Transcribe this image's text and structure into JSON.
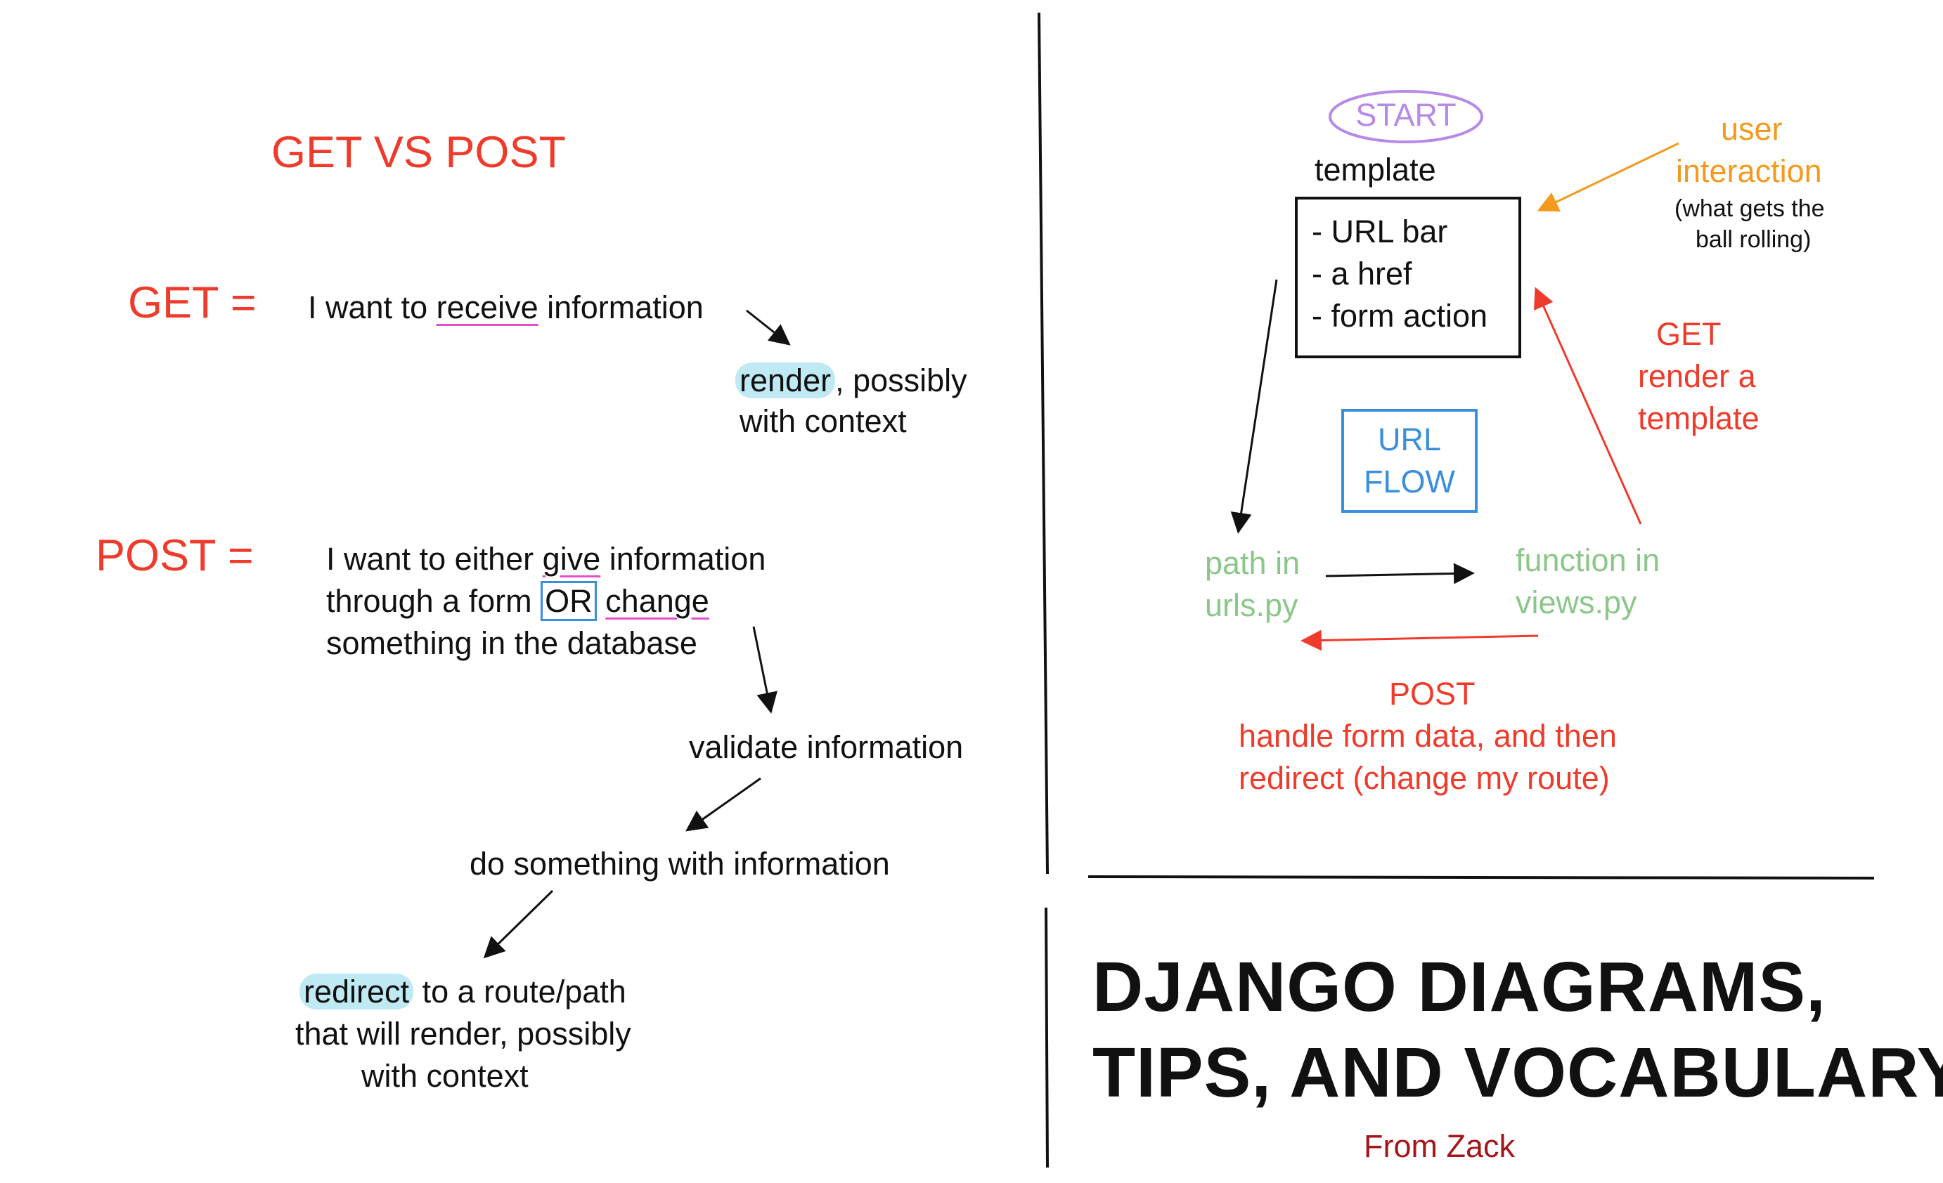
{
  "left": {
    "heading": "GET VS POST",
    "get_label": "GET =",
    "get_pre": "I want to ",
    "get_keyword": "receive",
    "get_post": " information",
    "render_keyword": "render",
    "render_rest": ", possibly",
    "render_line2": "with context",
    "post_label": "POST =",
    "post_line1_pre": "I want to either ",
    "post_line1_keyword": "give",
    "post_line1_post": " information",
    "post_line2_pre": "through a form ",
    "post_line2_or": "OR",
    "post_line2_keyword": "change",
    "post_line3": "something in the database",
    "validate": "validate information",
    "do_something": "do something with information",
    "redirect_keyword": "redirect",
    "redirect_rest": " to a route/path",
    "redirect_line2": "that will render, possibly",
    "redirect_line3": "with context"
  },
  "flow": {
    "start": "START",
    "template_label": "template",
    "template_items": [
      "- URL bar",
      "- a href",
      "- form action"
    ],
    "user_interaction": [
      "user",
      "interaction"
    ],
    "user_note": [
      "(what gets the",
      "ball rolling)"
    ],
    "get_note": [
      "GET",
      "render a",
      "template"
    ],
    "center_box": [
      "URL",
      "FLOW"
    ],
    "path_node": [
      "path in",
      "urls.py"
    ],
    "function_node": [
      "function in",
      "views.py"
    ],
    "post_note": [
      "POST",
      "handle form data, and then",
      "redirect (change my route)"
    ]
  },
  "title": {
    "line1": "DJANGO DIAGRAMS,",
    "line2": "TIPS, AND VOCABULARY",
    "author": "From Zack"
  },
  "colors": {
    "red": "#ee3b2b",
    "green": "#8cc78a",
    "blue": "#3a8fdc",
    "orange": "#f39a1e",
    "purple": "#b68ae6",
    "maroon": "#a4161a",
    "highlight": "#bfe9f3",
    "underline": "#e74ec8"
  }
}
